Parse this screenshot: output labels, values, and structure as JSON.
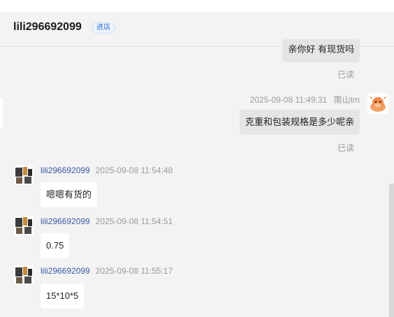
{
  "header": {
    "name": "lili296692099",
    "badge": "进店"
  },
  "messages_top": [
    {
      "text": "亲你好 有现货吗",
      "status": "已读"
    }
  ],
  "self_message": {
    "time": "2025-09-08 11:49:31",
    "sender": "南山tm",
    "text": "克重和包装规格是多少呢亲",
    "status": "已读"
  },
  "incoming": [
    {
      "sender": "lili296692099",
      "time": "2025-09-08 11:54:48",
      "text": "嗯嗯有货的"
    },
    {
      "sender": "lili296692099",
      "time": "2025-09-08 11:54:51",
      "text": "0.75"
    },
    {
      "sender": "lili296692099",
      "time": "2025-09-08 11:55:17",
      "text": "15*10*5"
    }
  ],
  "colors": {
    "background": "#f3f3f3",
    "bubble_out": "#e5e5e5",
    "bubble_in": "#ffffff",
    "username": "#3a5aa5",
    "badge": "#2f6fd6"
  },
  "icons": {
    "self_avatar": "cow-avatar-icon",
    "user_avatar": "product-thumbnail-avatar"
  }
}
